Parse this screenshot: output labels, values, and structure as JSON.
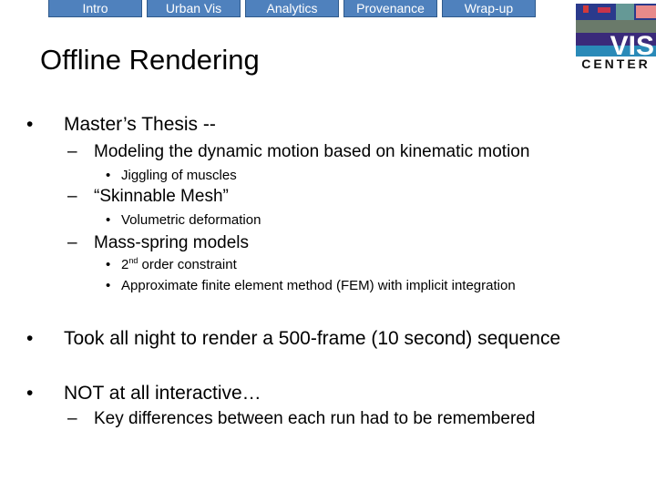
{
  "nav": {
    "tabs": [
      {
        "label": "Intro"
      },
      {
        "label": "Urban Vis"
      },
      {
        "label": "Analytics"
      },
      {
        "label": "Provenance"
      },
      {
        "label": "Wrap-up"
      }
    ],
    "color": "#4f81bd"
  },
  "logo": {
    "top_text": "VIS",
    "bottom_text": "CENTER"
  },
  "slide": {
    "title": "Offline Rendering",
    "bullets": {
      "b1": "Master’s Thesis --",
      "b1_1": "Modeling the dynamic motion based on kinematic motion",
      "b1_1_1": "Jiggling of muscles",
      "b1_2": "“Skinnable Mesh”",
      "b1_2_1": "Volumetric deformation",
      "b1_3": "Mass-spring models",
      "b1_3_1_sup_num": "2",
      "b1_3_1_sup": "nd",
      "b1_3_1_rest": " order constraint",
      "b1_3_2": "Approximate finite element method (FEM) with implicit integration",
      "b2": "Took all night to render a 500-frame (10 second) sequence",
      "b3": "NOT at all interactive…",
      "b3_1": "Key differences between each run had to be remembered"
    },
    "markers": {
      "level1": "•",
      "level2": "–",
      "level3": "•"
    }
  }
}
